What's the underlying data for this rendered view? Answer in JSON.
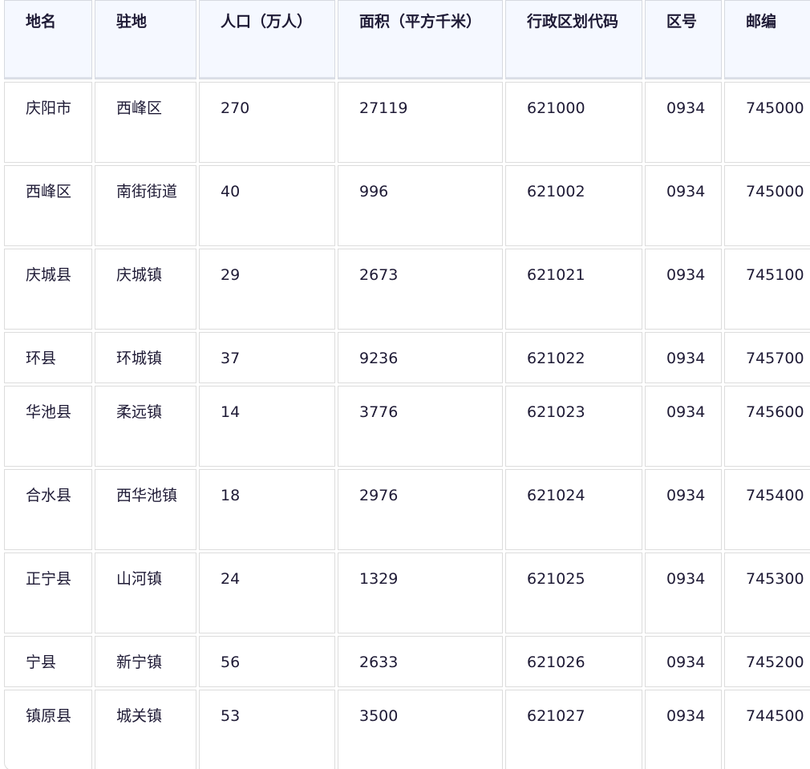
{
  "table": {
    "columns": [
      "地名",
      "驻地",
      "人口（万人）",
      "面积（平方千米）",
      "行政区划代码",
      "区号",
      "邮编"
    ],
    "rows": [
      [
        "庆阳市",
        "西峰区",
        "270",
        "27119",
        "621000",
        "0934",
        "745000"
      ],
      [
        "西峰区",
        "南街街道",
        "40",
        "996",
        "621002",
        "0934",
        "745000"
      ],
      [
        "庆城县",
        "庆城镇",
        "29",
        "2673",
        "621021",
        "0934",
        "745100"
      ],
      [
        "环县",
        "环城镇",
        "37",
        "9236",
        "621022",
        "0934",
        "745700"
      ],
      [
        "华池县",
        "柔远镇",
        "14",
        "3776",
        "621023",
        "0934",
        "745600"
      ],
      [
        "合水县",
        "西华池镇",
        "18",
        "2976",
        "621024",
        "0934",
        "745400"
      ],
      [
        "正宁县",
        "山河镇",
        "24",
        "1329",
        "621025",
        "0934",
        "745300"
      ],
      [
        "宁县",
        "新宁镇",
        "56",
        "2633",
        "621026",
        "0934",
        "745200"
      ],
      [
        "镇原县",
        "城关镇",
        "53",
        "3500",
        "621027",
        "0934",
        "744500"
      ]
    ]
  }
}
